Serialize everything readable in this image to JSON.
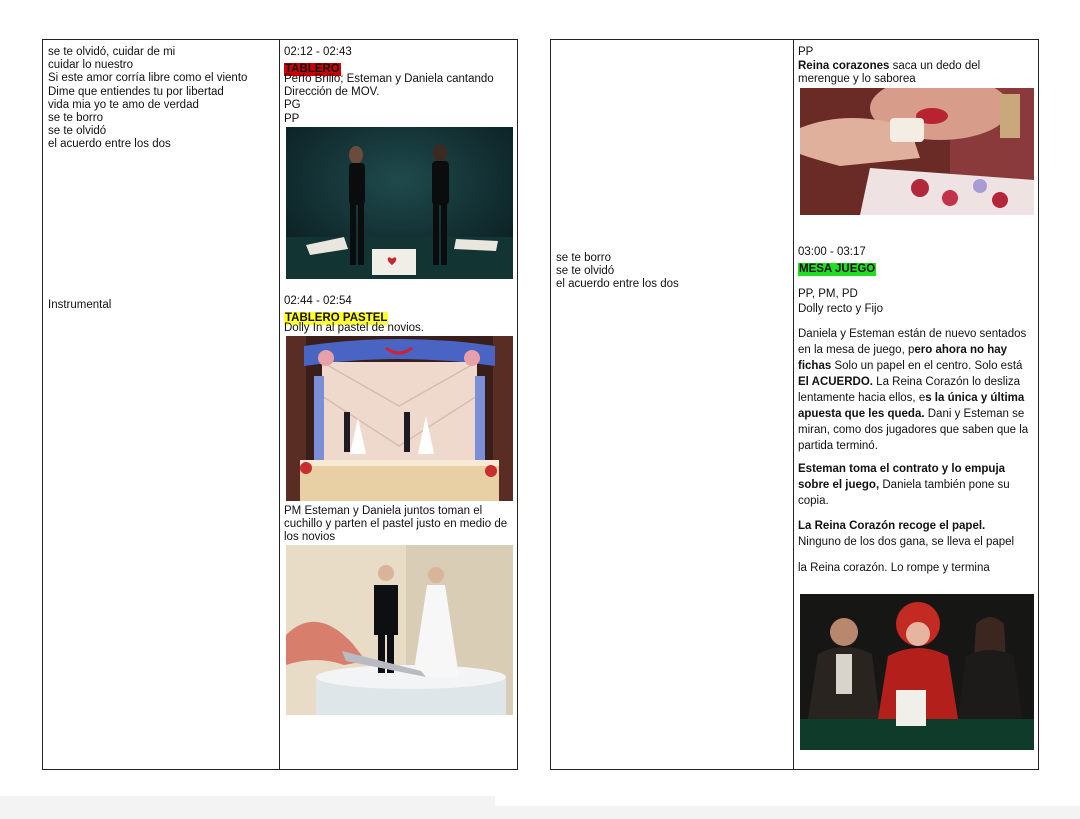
{
  "left_page": {
    "lyrics_1": "se te olvidó, cuidar de mi\ncuidar lo nuestro\nSi este amor corría libre como el viento\nDime que entiendes tu por libertad\nvida mia yo te amo de verdad\nse te borro\nse te olvidó\nel acuerdo entre los dos",
    "lyrics_2": "Instrumental",
    "scene_1": {
      "time": "02:12 - 02:43",
      "tag": "TABLERO",
      "tag_color": "#cc0000",
      "notes": "Perfo Brillo; Esteman y Daniela cantando\nDirección de MOV.\nPG\nPP"
    },
    "scene_2": {
      "time": "02:44 - 02:54",
      "tag": "TABLERO PASTEL",
      "tag_color": "#ffff33",
      "notes": "Dolly In al pastel de novios.",
      "notes_2": "PM Esteman y Daniela juntos toman el\ncuchillo y parten el pastel justo en medio de\nlos novios"
    }
  },
  "right_page": {
    "lyrics": "se te borro\nse te olvidó\nel acuerdo entre los dos",
    "top": {
      "shot": "PP",
      "bold": "Reina corazones",
      "rest": " saca un dedo del\nmerengue y lo saborea"
    },
    "scene_3": {
      "time": "03:00 - 03:17",
      "tag": "MESA JUEGO",
      "tag_color": "#22dd22",
      "notes": "PP, PM, PD\nDolly recto y Fijo",
      "p1_a": "Daniela y Esteman están de nuevo sentados en la mesa de juego, p",
      "p1_b": "ero ahora no hay fichas",
      "p1_c": " Solo un papel en el centro. Solo está ",
      "p1_d": "El ACUERDO.",
      "p1_e": " La Reina Corazón lo desliza lentamente hacia ellos, e",
      "p1_f": "s la única y última apuesta que les queda.",
      "p1_g": " Dani y Esteman se miran, como dos jugadores que saben que la partida terminó.",
      "p2_a": "Esteman toma el contrato y lo empuja sobre el juego,",
      "p2_b": " Daniela también pone su copia.",
      "p3_a": "La Reina Corazón recoge el papel.",
      "p3_b": "\nNinguno de los dos gana, se lleva el papel",
      "p4": "la Reina corazón. Lo  rompe y termina"
    }
  }
}
